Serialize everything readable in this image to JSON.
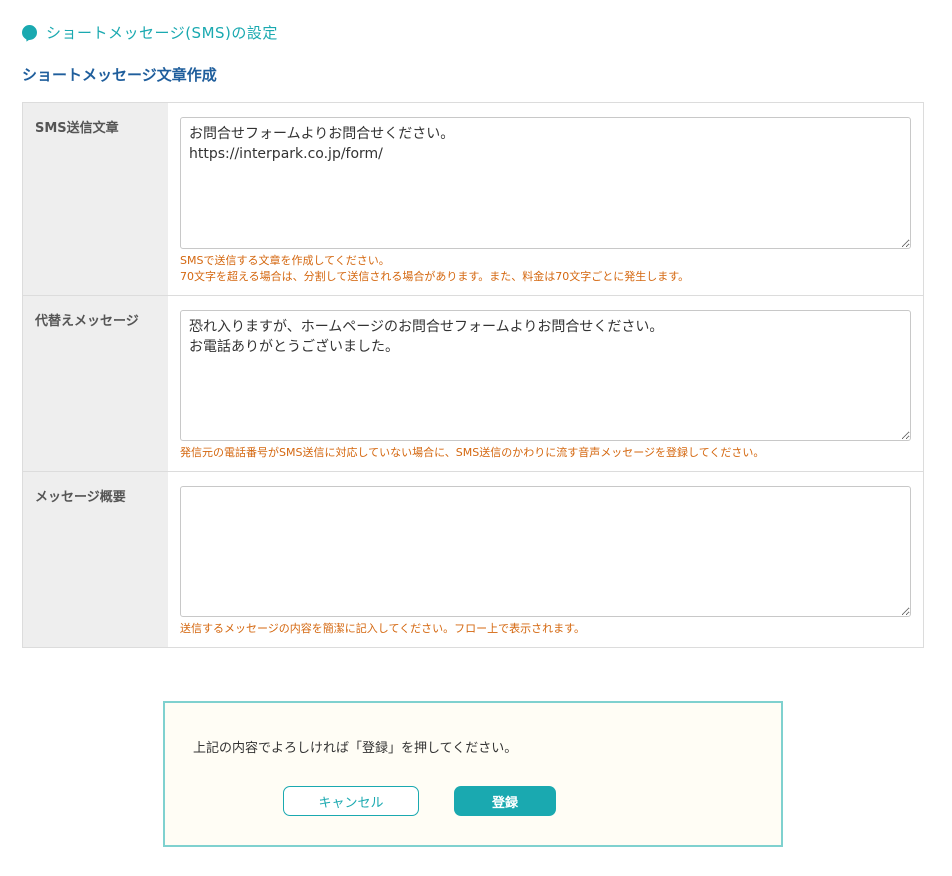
{
  "header": {
    "title": "ショートメッセージ(SMS)の設定"
  },
  "section": {
    "title": "ショートメッセージ文章作成"
  },
  "form": {
    "rows": [
      {
        "label": "SMS送信文章",
        "value": "お問合せフォームよりお問合せください。\nhttps://interpark.co.jp/form/",
        "hints": [
          "SMSで送信する文章を作成してください。",
          "70文字を超える場合は、分割して送信される場合があります。また、料金は70文字ごとに発生します。"
        ]
      },
      {
        "label": "代替えメッセージ",
        "value": "恐れ入りますが、ホームページのお問合せフォームよりお問合せください。\nお電話ありがとうございました。",
        "hints": [
          "発信元の電話番号がSMS送信に対応していない場合に、SMS送信のかわりに流す音声メッセージを登録してください。"
        ]
      },
      {
        "label": "メッセージ概要",
        "value": "",
        "hints": [
          "送信するメッセージの内容を簡潔に記入してください。フロー上で表示されます。"
        ]
      }
    ]
  },
  "confirm": {
    "text": "上記の内容でよろしければ「登録」を押してください。",
    "cancel_label": "キャンセル",
    "submit_label": "登録"
  },
  "colors": {
    "accent": "#1aa9b0",
    "section_title": "#1f5e9c",
    "hint": "#d4670f"
  }
}
